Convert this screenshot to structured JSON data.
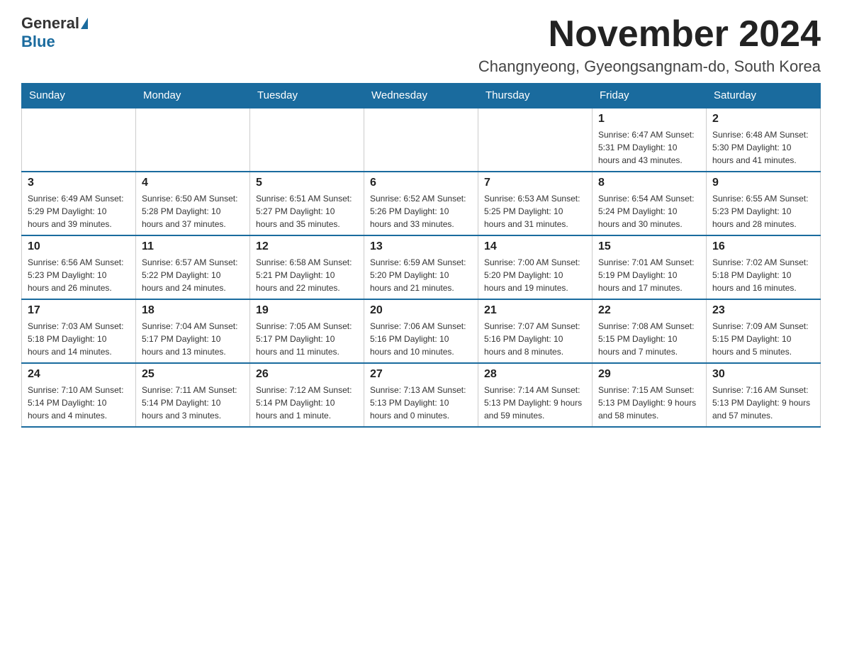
{
  "header": {
    "logo_general": "General",
    "logo_blue": "Blue",
    "month_title": "November 2024",
    "location": "Changnyeong, Gyeongsangnam-do, South Korea"
  },
  "days_of_week": [
    "Sunday",
    "Monday",
    "Tuesday",
    "Wednesday",
    "Thursday",
    "Friday",
    "Saturday"
  ],
  "weeks": [
    {
      "days": [
        {
          "number": "",
          "info": ""
        },
        {
          "number": "",
          "info": ""
        },
        {
          "number": "",
          "info": ""
        },
        {
          "number": "",
          "info": ""
        },
        {
          "number": "",
          "info": ""
        },
        {
          "number": "1",
          "info": "Sunrise: 6:47 AM\nSunset: 5:31 PM\nDaylight: 10 hours and 43 minutes."
        },
        {
          "number": "2",
          "info": "Sunrise: 6:48 AM\nSunset: 5:30 PM\nDaylight: 10 hours and 41 minutes."
        }
      ]
    },
    {
      "days": [
        {
          "number": "3",
          "info": "Sunrise: 6:49 AM\nSunset: 5:29 PM\nDaylight: 10 hours and 39 minutes."
        },
        {
          "number": "4",
          "info": "Sunrise: 6:50 AM\nSunset: 5:28 PM\nDaylight: 10 hours and 37 minutes."
        },
        {
          "number": "5",
          "info": "Sunrise: 6:51 AM\nSunset: 5:27 PM\nDaylight: 10 hours and 35 minutes."
        },
        {
          "number": "6",
          "info": "Sunrise: 6:52 AM\nSunset: 5:26 PM\nDaylight: 10 hours and 33 minutes."
        },
        {
          "number": "7",
          "info": "Sunrise: 6:53 AM\nSunset: 5:25 PM\nDaylight: 10 hours and 31 minutes."
        },
        {
          "number": "8",
          "info": "Sunrise: 6:54 AM\nSunset: 5:24 PM\nDaylight: 10 hours and 30 minutes."
        },
        {
          "number": "9",
          "info": "Sunrise: 6:55 AM\nSunset: 5:23 PM\nDaylight: 10 hours and 28 minutes."
        }
      ]
    },
    {
      "days": [
        {
          "number": "10",
          "info": "Sunrise: 6:56 AM\nSunset: 5:23 PM\nDaylight: 10 hours and 26 minutes."
        },
        {
          "number": "11",
          "info": "Sunrise: 6:57 AM\nSunset: 5:22 PM\nDaylight: 10 hours and 24 minutes."
        },
        {
          "number": "12",
          "info": "Sunrise: 6:58 AM\nSunset: 5:21 PM\nDaylight: 10 hours and 22 minutes."
        },
        {
          "number": "13",
          "info": "Sunrise: 6:59 AM\nSunset: 5:20 PM\nDaylight: 10 hours and 21 minutes."
        },
        {
          "number": "14",
          "info": "Sunrise: 7:00 AM\nSunset: 5:20 PM\nDaylight: 10 hours and 19 minutes."
        },
        {
          "number": "15",
          "info": "Sunrise: 7:01 AM\nSunset: 5:19 PM\nDaylight: 10 hours and 17 minutes."
        },
        {
          "number": "16",
          "info": "Sunrise: 7:02 AM\nSunset: 5:18 PM\nDaylight: 10 hours and 16 minutes."
        }
      ]
    },
    {
      "days": [
        {
          "number": "17",
          "info": "Sunrise: 7:03 AM\nSunset: 5:18 PM\nDaylight: 10 hours and 14 minutes."
        },
        {
          "number": "18",
          "info": "Sunrise: 7:04 AM\nSunset: 5:17 PM\nDaylight: 10 hours and 13 minutes."
        },
        {
          "number": "19",
          "info": "Sunrise: 7:05 AM\nSunset: 5:17 PM\nDaylight: 10 hours and 11 minutes."
        },
        {
          "number": "20",
          "info": "Sunrise: 7:06 AM\nSunset: 5:16 PM\nDaylight: 10 hours and 10 minutes."
        },
        {
          "number": "21",
          "info": "Sunrise: 7:07 AM\nSunset: 5:16 PM\nDaylight: 10 hours and 8 minutes."
        },
        {
          "number": "22",
          "info": "Sunrise: 7:08 AM\nSunset: 5:15 PM\nDaylight: 10 hours and 7 minutes."
        },
        {
          "number": "23",
          "info": "Sunrise: 7:09 AM\nSunset: 5:15 PM\nDaylight: 10 hours and 5 minutes."
        }
      ]
    },
    {
      "days": [
        {
          "number": "24",
          "info": "Sunrise: 7:10 AM\nSunset: 5:14 PM\nDaylight: 10 hours and 4 minutes."
        },
        {
          "number": "25",
          "info": "Sunrise: 7:11 AM\nSunset: 5:14 PM\nDaylight: 10 hours and 3 minutes."
        },
        {
          "number": "26",
          "info": "Sunrise: 7:12 AM\nSunset: 5:14 PM\nDaylight: 10 hours and 1 minute."
        },
        {
          "number": "27",
          "info": "Sunrise: 7:13 AM\nSunset: 5:13 PM\nDaylight: 10 hours and 0 minutes."
        },
        {
          "number": "28",
          "info": "Sunrise: 7:14 AM\nSunset: 5:13 PM\nDaylight: 9 hours and 59 minutes."
        },
        {
          "number": "29",
          "info": "Sunrise: 7:15 AM\nSunset: 5:13 PM\nDaylight: 9 hours and 58 minutes."
        },
        {
          "number": "30",
          "info": "Sunrise: 7:16 AM\nSunset: 5:13 PM\nDaylight: 9 hours and 57 minutes."
        }
      ]
    }
  ]
}
